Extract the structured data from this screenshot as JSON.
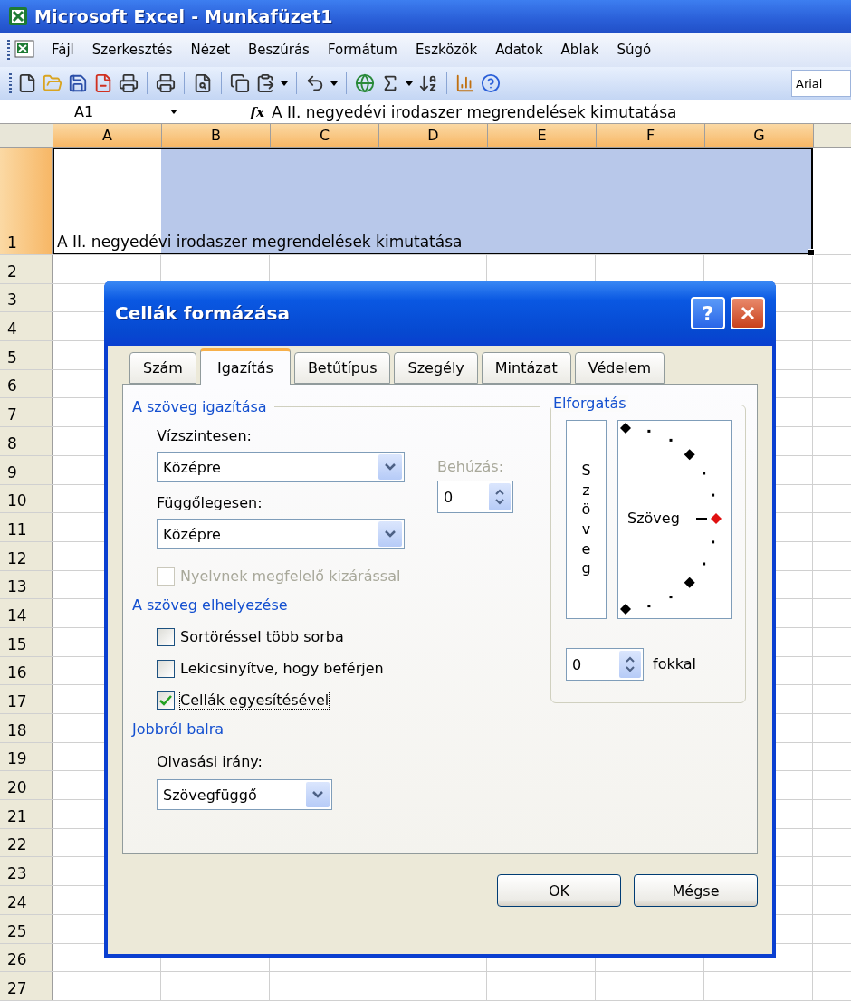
{
  "window": {
    "title": "Microsoft Excel - Munkafüzet1"
  },
  "menu": [
    "Fájl",
    "Szerkesztés",
    "Nézet",
    "Beszúrás",
    "Formátum",
    "Eszközök",
    "Adatok",
    "Ablak",
    "Súgó"
  ],
  "toolbar": {
    "font": "Arial"
  },
  "formula_bar": {
    "name_box": "A1",
    "function_label": "fx",
    "content": "A II. negyedévi irodaszer megrendelések kimutatása"
  },
  "sheet": {
    "columns": [
      {
        "label": "A",
        "selected": true
      },
      {
        "label": "B",
        "selected": true
      },
      {
        "label": "C",
        "selected": true
      },
      {
        "label": "D",
        "selected": true
      },
      {
        "label": "E",
        "selected": true
      },
      {
        "label": "F",
        "selected": true
      },
      {
        "label": "G",
        "selected": true
      }
    ],
    "rows": [
      "1",
      "2",
      "3",
      "4",
      "5",
      "6",
      "7",
      "8",
      "9",
      "10",
      "11",
      "12",
      "13",
      "14",
      "15",
      "16",
      "17",
      "18",
      "19",
      "20",
      "21",
      "22",
      "23",
      "24",
      "25",
      "26",
      "27"
    ],
    "cell_a1": "A II. negyedévi irodaszer megrendelések kimutatása"
  },
  "dialog": {
    "title": "Cellák formázása",
    "help": "?",
    "tabs": [
      {
        "label": "Szám",
        "selected": false
      },
      {
        "label": "Igazítás",
        "selected": true
      },
      {
        "label": "Betűtípus",
        "selected": false
      },
      {
        "label": "Szegély",
        "selected": false
      },
      {
        "label": "Mintázat",
        "selected": false
      },
      {
        "label": "Védelem",
        "selected": false
      }
    ],
    "alignment": {
      "heading": "A szöveg igazítása",
      "horizontal": {
        "label": "Vízszintesen:",
        "value": "Középre"
      },
      "vertical": {
        "label": "Függőlegesen:",
        "value": "Középre"
      },
      "indent": {
        "label": "Behúzás:",
        "value": "0",
        "disabled": true
      },
      "justify": {
        "label": "Nyelvnek megfelelő kizárással",
        "checked": false,
        "disabled": true
      }
    },
    "control": {
      "heading": "A szöveg elhelyezése",
      "options": [
        {
          "label": "Sortöréssel több sorba",
          "checked": false,
          "disabled": false
        },
        {
          "label": "Lekicsinyítve, hogy beférjen",
          "checked": false,
          "disabled": false
        },
        {
          "label": "Cellák egyesítésével",
          "checked": true,
          "disabled": false
        }
      ]
    },
    "right_to_left": {
      "heading": "Jobbról balra",
      "direction": {
        "label": "Olvasási irány:",
        "value": "Szövegfüggő"
      }
    },
    "orientation": {
      "heading": "Elforgatás",
      "vertical_text": "Szöveg",
      "dial_text": "Szöveg",
      "degrees": {
        "value": "0",
        "label": "fokkal"
      }
    },
    "buttons": [
      "OK",
      "Mégse"
    ]
  }
}
